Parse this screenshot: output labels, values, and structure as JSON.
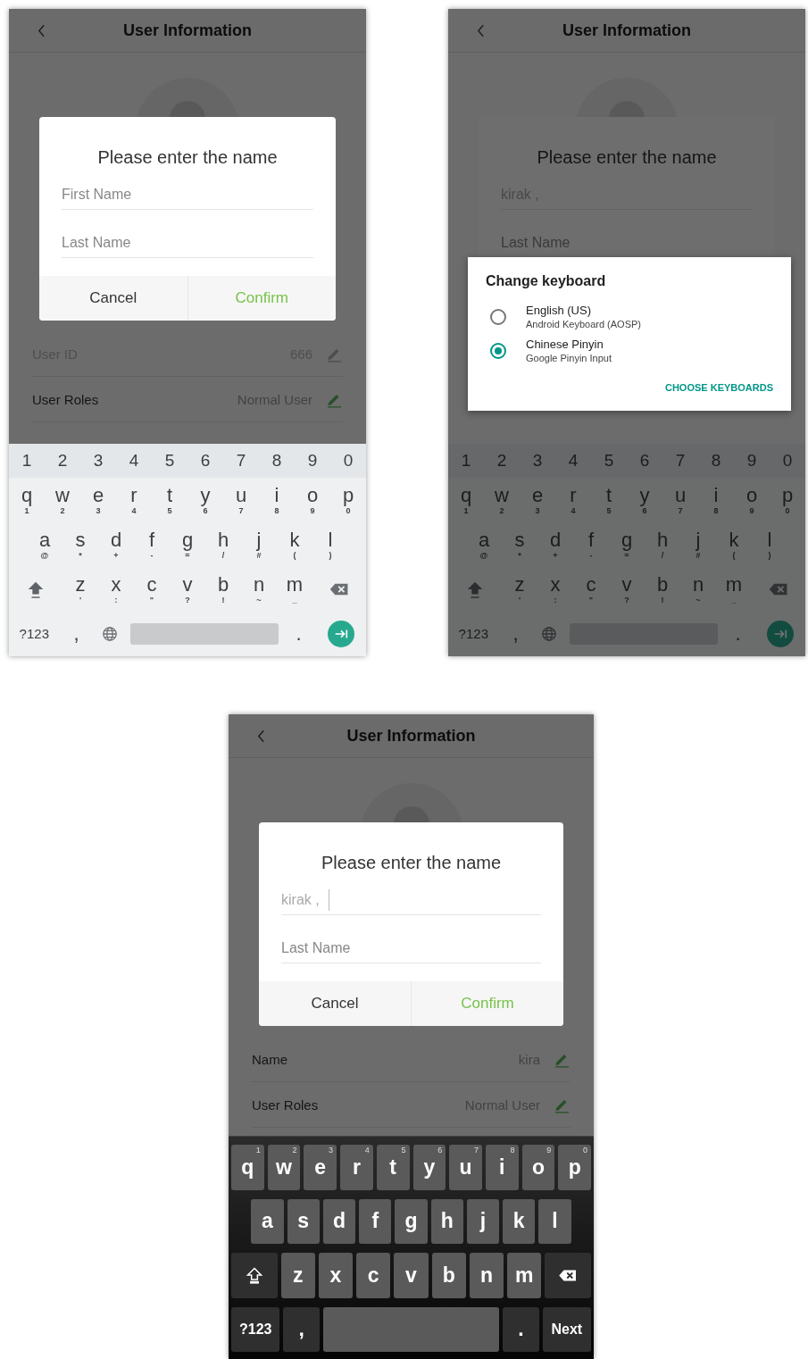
{
  "phones": [
    {
      "header": {
        "title": "User Information"
      },
      "rows": [
        {
          "label": "User ID",
          "value": "666",
          "disabled": true
        },
        {
          "label": "User Roles",
          "value": "Normal User",
          "disabled": false
        }
      ],
      "name_dialog": {
        "title": "Please enter the name",
        "dimmed": false,
        "fields": [
          {
            "placeholder": "First Name",
            "focused": false
          },
          {
            "placeholder": "Last Name",
            "focused": false
          }
        ],
        "buttons": [
          {
            "label": "Cancel",
            "kind": "cancel"
          },
          {
            "label": "Confirm",
            "kind": "confirm"
          }
        ]
      },
      "keyboard": {
        "kind": "light",
        "dimmed": false,
        "number_row": [
          "1",
          "2",
          "3",
          "4",
          "5",
          "6",
          "7",
          "8",
          "9",
          "0"
        ],
        "rows": [
          {
            "keys": [
              {
                "kind": "char",
                "label": "q",
                "hint": "1"
              },
              {
                "kind": "char",
                "label": "w",
                "hint": "2"
              },
              {
                "kind": "char",
                "label": "e",
                "hint": "3"
              },
              {
                "kind": "char",
                "label": "r",
                "hint": "4"
              },
              {
                "kind": "char",
                "label": "t",
                "hint": "5"
              },
              {
                "kind": "char",
                "label": "y",
                "hint": "6"
              },
              {
                "kind": "char",
                "label": "u",
                "hint": "7"
              },
              {
                "kind": "char",
                "label": "i",
                "hint": "8"
              },
              {
                "kind": "char",
                "label": "o",
                "hint": "9"
              },
              {
                "kind": "char",
                "label": "p",
                "hint": "0"
              }
            ]
          },
          {
            "keys": [
              {
                "kind": "char",
                "label": "a",
                "hint": "@"
              },
              {
                "kind": "char",
                "label": "s",
                "hint": "*"
              },
              {
                "kind": "char",
                "label": "d",
                "hint": "+"
              },
              {
                "kind": "char",
                "label": "f",
                "hint": "-"
              },
              {
                "kind": "char",
                "label": "g",
                "hint": "="
              },
              {
                "kind": "char",
                "label": "h",
                "hint": "/"
              },
              {
                "kind": "char",
                "label": "j",
                "hint": "#"
              },
              {
                "kind": "char",
                "label": "k",
                "hint": "("
              },
              {
                "kind": "char",
                "label": "l",
                "hint": ")"
              }
            ]
          },
          {
            "keys": [
              {
                "kind": "shift"
              },
              {
                "kind": "char",
                "label": "z",
                "hint": "'"
              },
              {
                "kind": "char",
                "label": "x",
                "hint": ":"
              },
              {
                "kind": "char",
                "label": "c",
                "hint": "\""
              },
              {
                "kind": "char",
                "label": "v",
                "hint": "?"
              },
              {
                "kind": "char",
                "label": "b",
                "hint": "!"
              },
              {
                "kind": "char",
                "label": "n",
                "hint": "~"
              },
              {
                "kind": "char",
                "label": "m",
                "hint": "_"
              },
              {
                "kind": "backspace"
              }
            ]
          },
          {
            "keys": [
              {
                "kind": "function",
                "label": "?123"
              },
              {
                "kind": "punct",
                "label": ","
              },
              {
                "kind": "globe"
              },
              {
                "kind": "space"
              },
              {
                "kind": "punct",
                "label": "."
              },
              {
                "kind": "enter"
              }
            ]
          }
        ]
      }
    },
    {
      "header": {
        "title": "User Information"
      },
      "name_dialog": {
        "title": "Please enter the name",
        "dimmed": true,
        "fields": [
          {
            "value": "kirak ,",
            "focused": false
          },
          {
            "placeholder": "Last Name",
            "focused": false
          }
        ]
      },
      "keyboard": {
        "kind": "light",
        "dimmed": true,
        "number_row": [
          "1",
          "2",
          "3",
          "4",
          "5",
          "6",
          "7",
          "8",
          "9",
          "0"
        ],
        "rows": [
          {
            "keys": [
              {
                "kind": "char",
                "label": "q",
                "hint": "1"
              },
              {
                "kind": "char",
                "label": "w",
                "hint": "2"
              },
              {
                "kind": "char",
                "label": "e",
                "hint": "3"
              },
              {
                "kind": "char",
                "label": "r",
                "hint": "4"
              },
              {
                "kind": "char",
                "label": "t",
                "hint": "5"
              },
              {
                "kind": "char",
                "label": "y",
                "hint": "6"
              },
              {
                "kind": "char",
                "label": "u",
                "hint": "7"
              },
              {
                "kind": "char",
                "label": "i",
                "hint": "8"
              },
              {
                "kind": "char",
                "label": "o",
                "hint": "9"
              },
              {
                "kind": "char",
                "label": "p",
                "hint": "0"
              }
            ]
          },
          {
            "keys": [
              {
                "kind": "char",
                "label": "a",
                "hint": "@"
              },
              {
                "kind": "char",
                "label": "s",
                "hint": "*"
              },
              {
                "kind": "char",
                "label": "d",
                "hint": "+"
              },
              {
                "kind": "char",
                "label": "f",
                "hint": "-"
              },
              {
                "kind": "char",
                "label": "g",
                "hint": "="
              },
              {
                "kind": "char",
                "label": "h",
                "hint": "/"
              },
              {
                "kind": "char",
                "label": "j",
                "hint": "#"
              },
              {
                "kind": "char",
                "label": "k",
                "hint": "("
              },
              {
                "kind": "char",
                "label": "l",
                "hint": ")"
              }
            ]
          },
          {
            "keys": [
              {
                "kind": "shift"
              },
              {
                "kind": "char",
                "label": "z",
                "hint": "'"
              },
              {
                "kind": "char",
                "label": "x",
                "hint": ":"
              },
              {
                "kind": "char",
                "label": "c",
                "hint": "\""
              },
              {
                "kind": "char",
                "label": "v",
                "hint": "?"
              },
              {
                "kind": "char",
                "label": "b",
                "hint": "!"
              },
              {
                "kind": "char",
                "label": "n",
                "hint": "~"
              },
              {
                "kind": "char",
                "label": "m",
                "hint": "_"
              },
              {
                "kind": "backspace"
              }
            ]
          },
          {
            "keys": [
              {
                "kind": "function",
                "label": "?123"
              },
              {
                "kind": "punct",
                "label": ","
              },
              {
                "kind": "globe"
              },
              {
                "kind": "space"
              },
              {
                "kind": "punct",
                "label": "."
              },
              {
                "kind": "enter"
              }
            ]
          }
        ]
      },
      "picker": {
        "title": "Change keyboard",
        "options": [
          {
            "title": "English (US)",
            "subtitle": "Android Keyboard (AOSP)",
            "selected": false
          },
          {
            "title": "Chinese Pinyin",
            "subtitle": "Google Pinyin Input",
            "selected": true
          }
        ],
        "action": "CHOOSE KEYBOARDS"
      }
    },
    {
      "header": {
        "title": "User Information"
      },
      "rows": [
        {
          "label": "Name",
          "value": "kira",
          "disabled": false
        },
        {
          "label": "User Roles",
          "value": "Normal User",
          "disabled": false
        }
      ],
      "name_dialog": {
        "title": "Please enter the name",
        "dimmed": false,
        "fields": [
          {
            "value": "kirak ,",
            "focused": true
          },
          {
            "placeholder": "Last Name",
            "focused": false
          }
        ],
        "buttons": [
          {
            "label": "Cancel",
            "kind": "cancel"
          },
          {
            "label": "Confirm",
            "kind": "confirm"
          }
        ]
      },
      "keyboard": {
        "kind": "dark",
        "dimmed": false,
        "rows": [
          {
            "keys": [
              {
                "kind": "char",
                "label": "q",
                "hint": "1"
              },
              {
                "kind": "char",
                "label": "w",
                "hint": "2"
              },
              {
                "kind": "char",
                "label": "e",
                "hint": "3"
              },
              {
                "kind": "char",
                "label": "r",
                "hint": "4"
              },
              {
                "kind": "char",
                "label": "t",
                "hint": "5"
              },
              {
                "kind": "char",
                "label": "y",
                "hint": "6"
              },
              {
                "kind": "char",
                "label": "u",
                "hint": "7"
              },
              {
                "kind": "char",
                "label": "i",
                "hint": "8"
              },
              {
                "kind": "char",
                "label": "o",
                "hint": "9"
              },
              {
                "kind": "char",
                "label": "p",
                "hint": "0"
              }
            ]
          },
          {
            "keys": [
              {
                "kind": "char",
                "label": "a"
              },
              {
                "kind": "char",
                "label": "s"
              },
              {
                "kind": "char",
                "label": "d"
              },
              {
                "kind": "char",
                "label": "f"
              },
              {
                "kind": "char",
                "label": "g"
              },
              {
                "kind": "char",
                "label": "h"
              },
              {
                "kind": "char",
                "label": "j"
              },
              {
                "kind": "char",
                "label": "k"
              },
              {
                "kind": "char",
                "label": "l"
              }
            ]
          },
          {
            "keys": [
              {
                "kind": "shift"
              },
              {
                "kind": "char",
                "label": "z"
              },
              {
                "kind": "char",
                "label": "x"
              },
              {
                "kind": "char",
                "label": "c"
              },
              {
                "kind": "char",
                "label": "v"
              },
              {
                "kind": "char",
                "label": "b"
              },
              {
                "kind": "char",
                "label": "n"
              },
              {
                "kind": "char",
                "label": "m"
              },
              {
                "kind": "backspace"
              }
            ]
          },
          {
            "keys": [
              {
                "kind": "function",
                "label": "?123"
              },
              {
                "kind": "punct",
                "label": ","
              },
              {
                "kind": "space"
              },
              {
                "kind": "punct",
                "label": "."
              },
              {
                "kind": "function",
                "label": "Next"
              }
            ]
          }
        ]
      }
    }
  ]
}
